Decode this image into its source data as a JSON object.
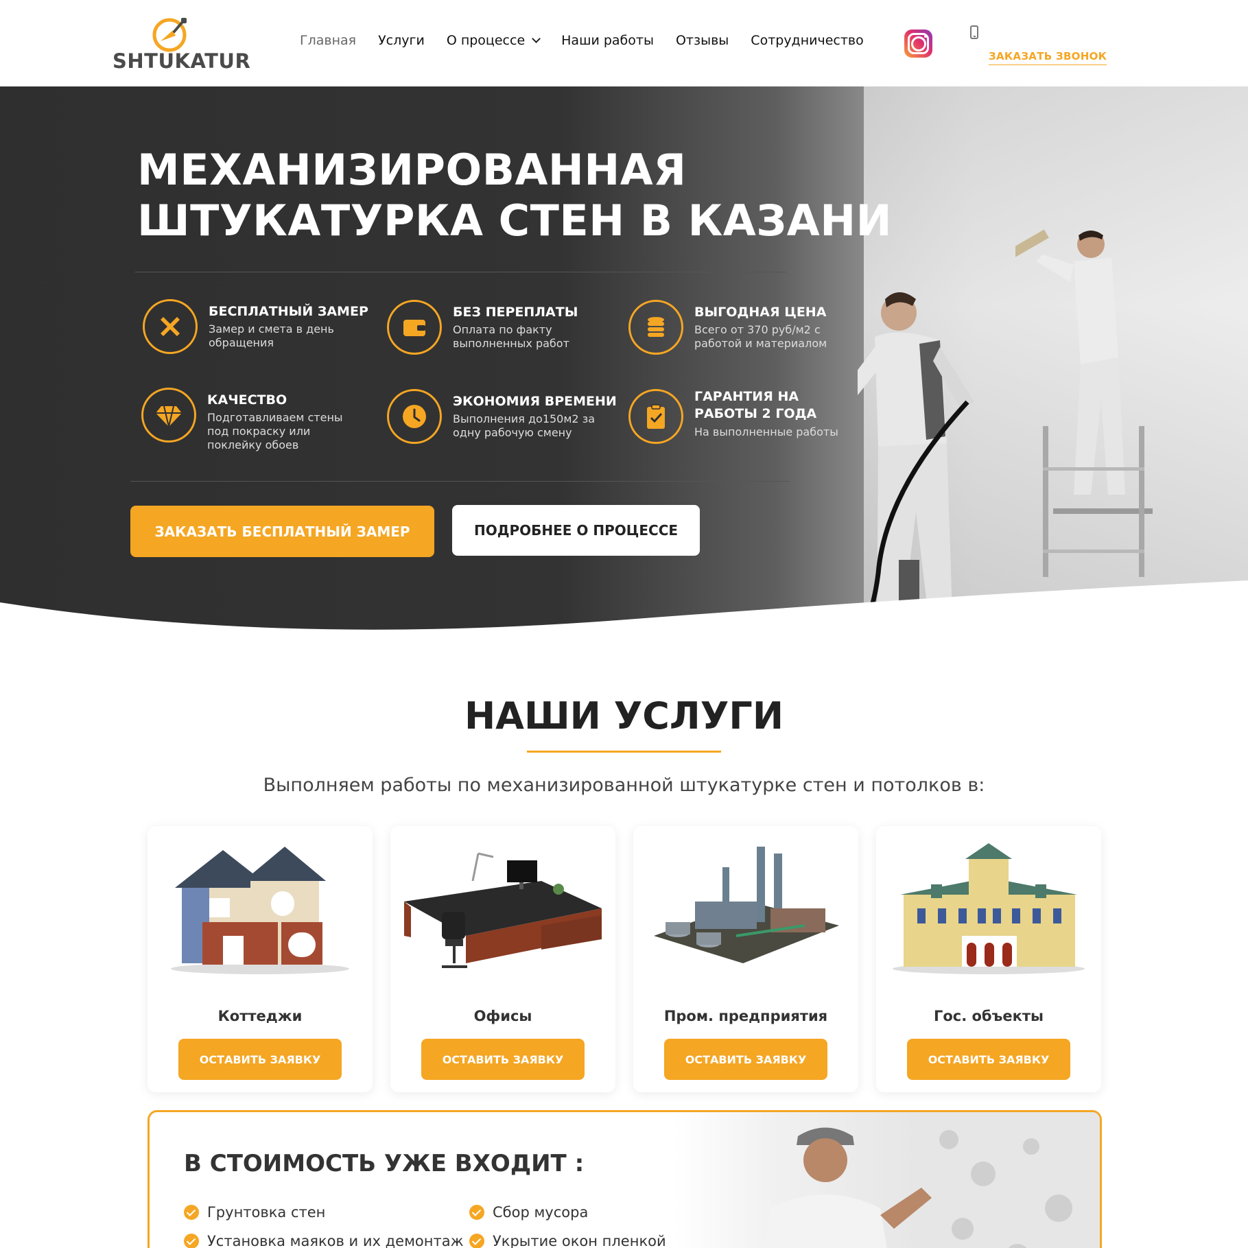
{
  "header": {
    "logo_text": "SHTUKATUR",
    "nav": [
      {
        "label": "Главная",
        "active": true
      },
      {
        "label": "Услуги"
      },
      {
        "label": "О процессе",
        "dropdown": true
      },
      {
        "label": "Наши работы"
      },
      {
        "label": "Отзывы"
      },
      {
        "label": "Сотрудничество"
      }
    ],
    "instagram_icon": "instagram-icon",
    "phone_icon": "phone-icon",
    "call_label": "ЗАКАЗАТЬ ЗВОНОК"
  },
  "hero": {
    "title_line1": "МЕХАНИЗИРОВАННАЯ",
    "title_line2": "ШТУКАТУРКА СТЕН В КАЗАНИ",
    "features": [
      {
        "icon": "ruler-pencil-icon",
        "title": "БЕСПЛАТНЫЙ ЗАМЕР",
        "desc1": "Замер и смета в день",
        "desc2": "обращения"
      },
      {
        "icon": "wallet-icon",
        "title": "БЕЗ ПЕРЕПЛАТЫ",
        "desc1": "Оплата по факту",
        "desc2": "выполненных работ"
      },
      {
        "icon": "coins-icon",
        "title": "ВЫГОДНАЯ ЦЕНА",
        "desc1": "Всего от 370 руб/м2 с",
        "desc2": "работой и материалом"
      },
      {
        "icon": "diamond-icon",
        "title": "КАЧЕСТВО",
        "desc1": "Подготавливаем стены",
        "desc2": "под покраску или",
        "desc3": "поклейку обоев"
      },
      {
        "icon": "clock-icon",
        "title": "ЭКОНОМИЯ ВРЕМЕНИ",
        "desc1": "Выполнения до150м2 за",
        "desc2": "одну рабочую смену"
      },
      {
        "icon": "clipboard-check-icon",
        "title1": "ГАРАНТИЯ НА",
        "title2": "РАБОТЫ 2 ГОДА",
        "desc1": "На выполненные работы"
      }
    ],
    "btn_primary": "ЗАКАЗАТЬ БЕСПЛАТНЫЙ ЗАМЕР",
    "btn_secondary": "ПОДРОБНЕЕ О ПРОЦЕССЕ"
  },
  "services": {
    "title": "НАШИ УСЛУГИ",
    "subtitle": "Выполняем работы по механизированной штукатурке стен и потолков в:",
    "cards": [
      {
        "name": "Коттеджи",
        "button": "ОСТАВИТЬ ЗАЯВКУ",
        "image": "cottage-image"
      },
      {
        "name": "Офисы",
        "button": "ОСТАВИТЬ ЗАЯВКУ",
        "image": "office-image"
      },
      {
        "name": "Пром. предприятия",
        "button": "ОСТАВИТЬ ЗАЯВКУ",
        "image": "factory-image"
      },
      {
        "name": "Гос. объекты",
        "button": "ОСТАВИТЬ ЗАЯВКУ",
        "image": "government-building-image"
      }
    ]
  },
  "price": {
    "title": "В СТОИМОСТЬ УЖЕ ВХОДИТ :",
    "items": [
      "Грунтовка стен",
      "Сбор мусора",
      "Установка маяков и их демонтаж",
      "Укрытие окон пленкой"
    ]
  },
  "colors": {
    "accent": "#f5a623",
    "dark": "#2f2f2f",
    "text": "#222222"
  }
}
